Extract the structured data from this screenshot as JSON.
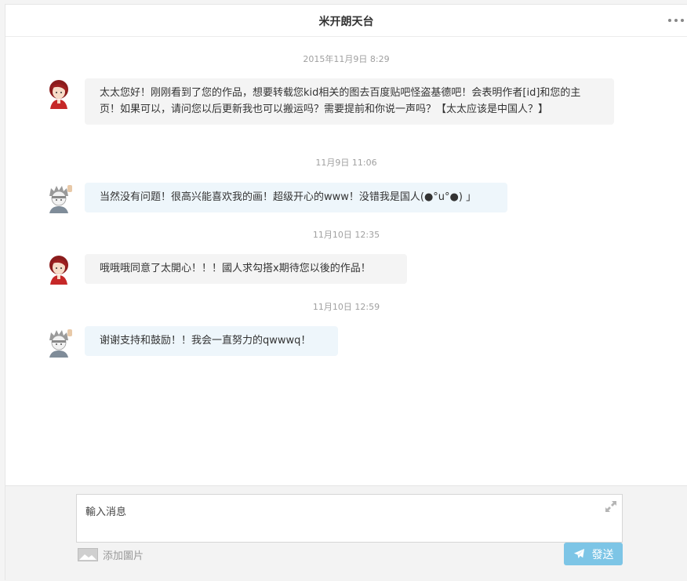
{
  "header": {
    "title": "米开朗天台"
  },
  "messages": [
    {
      "timestamp": "2015年11月9日 8:29",
      "sender": "other",
      "text": "太太您好！刚刚看到了您的作品，想要转载您kid相关的图去百度贴吧怪盗基德吧！会表明作者[id]和您的主页！如果可以，请问您以后更新我也可以搬运吗？需要提前和你说一声吗？【太太应该是中国人？】"
    },
    {
      "timestamp": "11月9日 11:06",
      "sender": "self",
      "text": "当然没有问题！很高兴能喜欢我的画！超级开心的www！没错我是国人(●°u°●)​ 」"
    },
    {
      "timestamp": "11月10日 12:35",
      "sender": "other",
      "text": "哦哦哦同意了太開心！！！國人求勾搭x期待您以後的作品！"
    },
    {
      "timestamp": "11月10日 12:59",
      "sender": "self",
      "text": "谢谢支持和鼓励！！我会一直努力的qwwwq！"
    }
  ],
  "composer": {
    "placeholder": "輸入消息",
    "add_image_label": "添加圖片",
    "send_label": "發送"
  },
  "icons": {
    "more": "more-dots-icon",
    "expand": "expand-icon",
    "image": "image-icon",
    "send": "paper-plane-icon"
  },
  "colors": {
    "send_button": "#7dc5e6",
    "bubble_other": "#f4f4f4",
    "bubble_self": "#eef6fb"
  }
}
